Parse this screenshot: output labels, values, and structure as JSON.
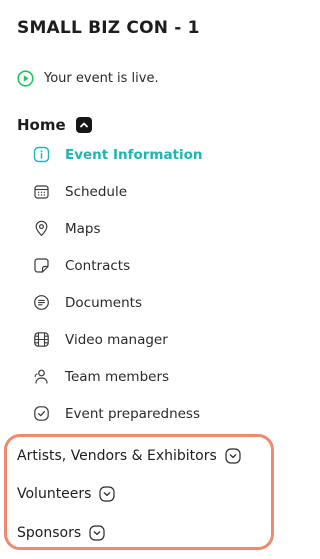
{
  "event": {
    "title": "SMALL BIZ CON - 1",
    "status_text": "Your event is live.",
    "status_icon": "play-circle-icon",
    "status_color": "#22c55e"
  },
  "home": {
    "label": "Home",
    "toggle_icon": "chevron-up-icon",
    "items": [
      {
        "label": "Event Information",
        "icon": "info-icon",
        "active": true
      },
      {
        "label": "Schedule",
        "icon": "calendar-icon",
        "active": false
      },
      {
        "label": "Maps",
        "icon": "map-pin-icon",
        "active": false
      },
      {
        "label": "Contracts",
        "icon": "contract-icon",
        "active": false
      },
      {
        "label": "Documents",
        "icon": "document-icon",
        "active": false
      },
      {
        "label": "Video manager",
        "icon": "film-icon",
        "active": false
      },
      {
        "label": "Team members",
        "icon": "team-icon",
        "active": false
      },
      {
        "label": "Event preparedness",
        "icon": "check-circle-icon",
        "active": false
      }
    ]
  },
  "sections": [
    {
      "label": "Artists, Vendors & Exhibitors",
      "icon": "chevron-down-icon"
    },
    {
      "label": "Volunteers",
      "icon": "chevron-down-icon"
    },
    {
      "label": "Sponsors",
      "icon": "chevron-down-icon"
    }
  ],
  "colors": {
    "accent": "#1fb5b5",
    "highlight": "#f08a6e",
    "live": "#22c55e"
  }
}
